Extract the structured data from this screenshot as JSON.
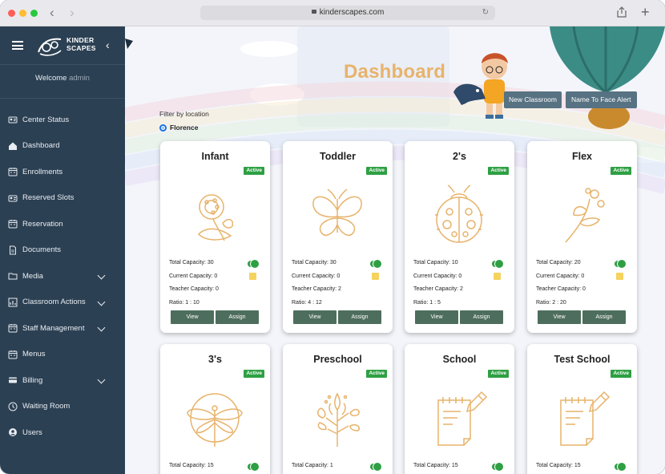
{
  "browser": {
    "url": "kinderscapes.com"
  },
  "sidebar": {
    "logo_line1": "KINDER",
    "logo_line2": "SCAPES",
    "welcome": "Welcome",
    "user": "admin",
    "items": [
      {
        "label": "Center Status",
        "icon": "user-card-icon"
      },
      {
        "label": "Dashboard",
        "icon": "home-icon"
      },
      {
        "label": "Enrollments",
        "icon": "calendar-icon"
      },
      {
        "label": "Reserved Slots",
        "icon": "user-card-icon"
      },
      {
        "label": "Reservation",
        "icon": "calendar-icon"
      },
      {
        "label": "Documents",
        "icon": "document-icon"
      },
      {
        "label": "Media",
        "icon": "folder-icon",
        "expandable": true
      },
      {
        "label": "Classroom Actions",
        "icon": "chart-icon",
        "expandable": true
      },
      {
        "label": "Staff Management",
        "icon": "calendar-icon",
        "expandable": true
      },
      {
        "label": "Menus",
        "icon": "calendar-icon"
      },
      {
        "label": "Billing",
        "icon": "card-icon",
        "expandable": true
      },
      {
        "label": "Waiting Room",
        "icon": "clock-icon"
      },
      {
        "label": "Users",
        "icon": "user-circle-icon"
      }
    ]
  },
  "main": {
    "title": "Dashboard",
    "new_classroom": "New Classroom",
    "name_to_face": "Name To Face Alert",
    "filter_label": "Filter by location",
    "location": "Florence"
  },
  "labels": {
    "total": "Total Capacity:",
    "current": "Current Capacity:",
    "teacher": "Teacher Capacity:",
    "ratio": "Ratio:",
    "view": "View",
    "assign": "Assign"
  },
  "classrooms": [
    {
      "name": "Infant",
      "status": "Active",
      "total": "30",
      "current": "0",
      "teacher": "0",
      "ratio": "1 : 10",
      "icon": "flower-icon"
    },
    {
      "name": "Toddler",
      "status": "Active",
      "total": "30",
      "current": "0",
      "teacher": "2",
      "ratio": "4 : 12",
      "icon": "butterfly-icon"
    },
    {
      "name": "2's",
      "status": "Active",
      "total": "10",
      "current": "0",
      "teacher": "2",
      "ratio": "1 : 5",
      "icon": "ladybug-icon"
    },
    {
      "name": "Flex",
      "status": "Active",
      "total": "20",
      "current": "0",
      "teacher": "0",
      "ratio": "2 : 20",
      "icon": "sprig-icon"
    },
    {
      "name": "3's",
      "status": "Active",
      "total": "15",
      "icon": "dragonfly-icon"
    },
    {
      "name": "Preschool",
      "status": "Active",
      "total": "1",
      "icon": "tree-icon"
    },
    {
      "name": "School",
      "status": "Active",
      "total": "15",
      "icon": "notepad-icon"
    },
    {
      "name": "Test School",
      "status": "Active",
      "total": "15",
      "icon": "notepad-icon"
    }
  ],
  "colors": {
    "sidebar": "#2c4053",
    "accent": "#e7b36b",
    "active": "#2ea043",
    "button": "#4e6e5d"
  }
}
